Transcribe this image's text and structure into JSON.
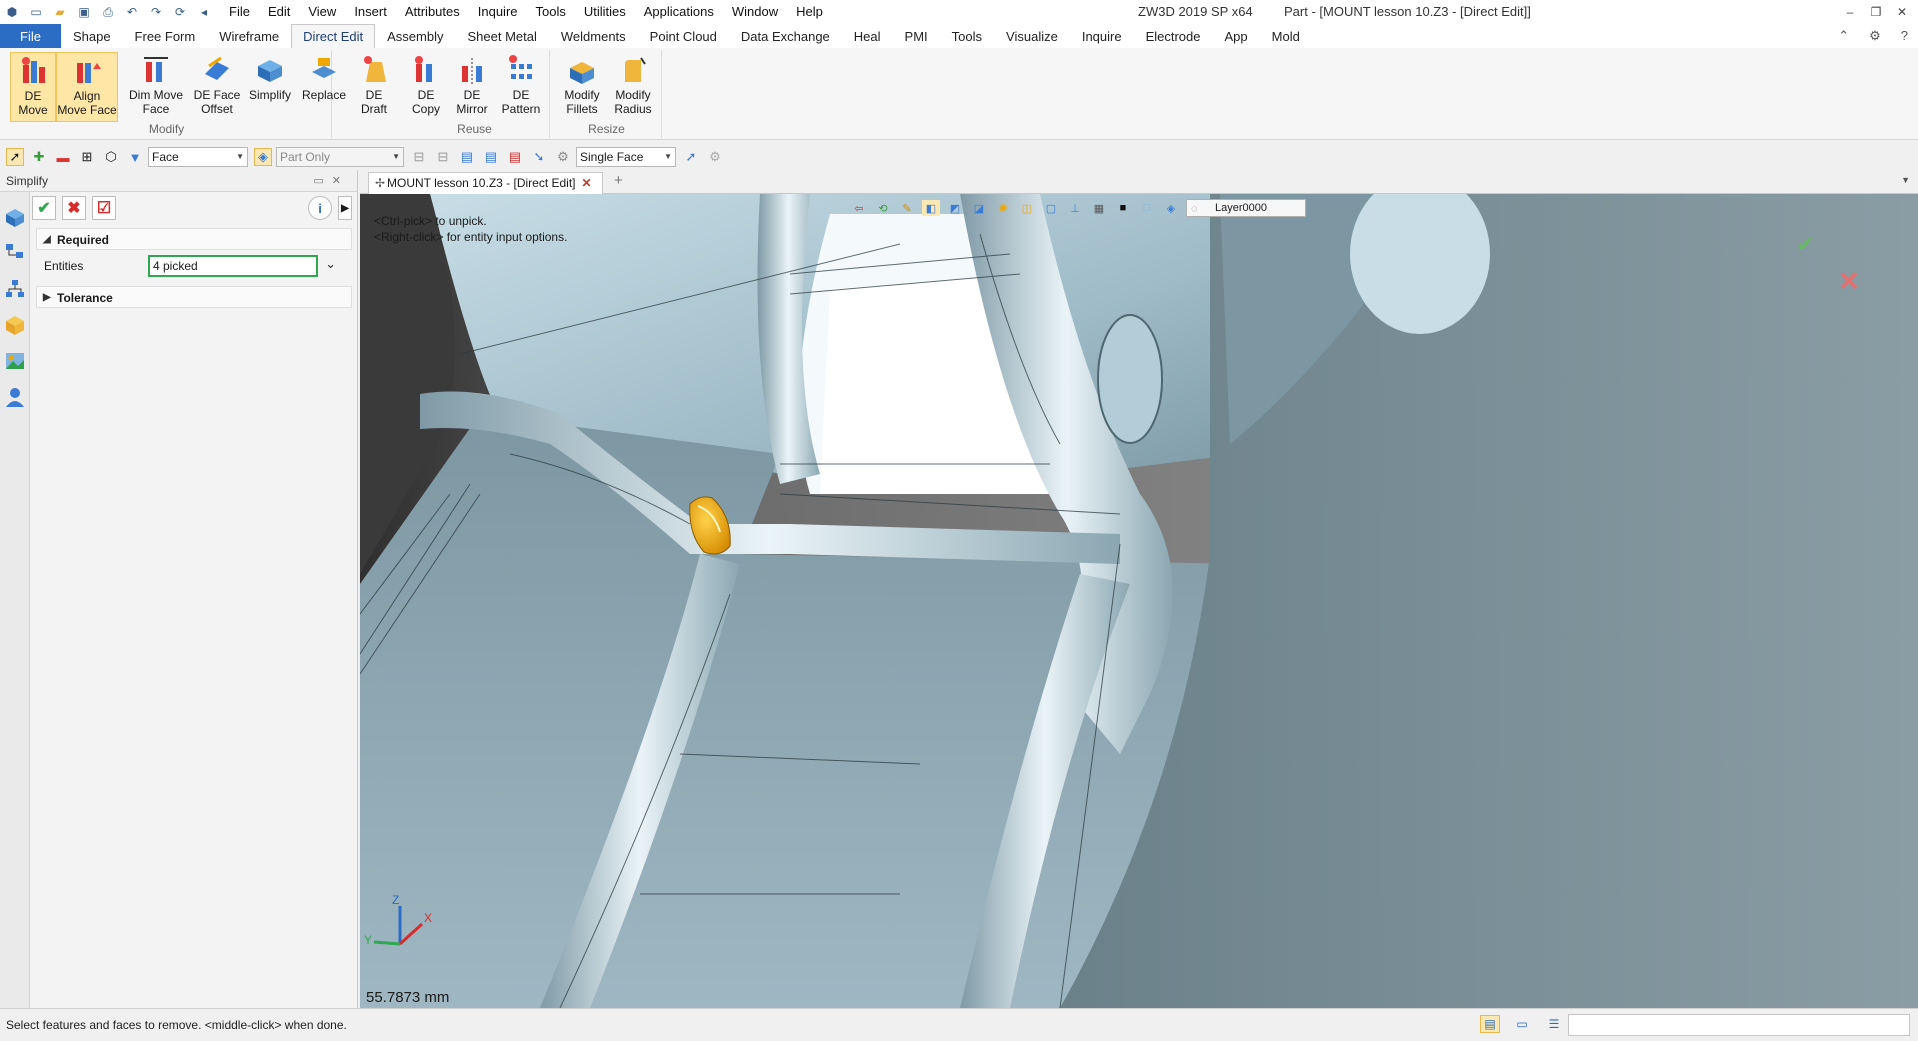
{
  "titlebar": {
    "menus": [
      "File",
      "Edit",
      "View",
      "Insert",
      "Attributes",
      "Inquire",
      "Tools",
      "Utilities",
      "Applications",
      "Window",
      "Help"
    ],
    "app_name": "ZW3D 2019 SP x64",
    "document_title": "Part - [MOUNT lesson 10.Z3 - [Direct Edit]]"
  },
  "ribbon_tabs": [
    "File",
    "Shape",
    "Free Form",
    "Wireframe",
    "Direct Edit",
    "Assembly",
    "Sheet Metal",
    "Weldments",
    "Point Cloud",
    "Data Exchange",
    "Heal",
    "PMI",
    "Tools",
    "Visualize",
    "Inquire",
    "Electrode",
    "App",
    "Mold"
  ],
  "active_tab": "Direct Edit",
  "ribbon": {
    "modify": {
      "label": "Modify",
      "buttons": [
        "DE\nMove",
        "Align\nMove Face",
        "Dim Move\nFace",
        "DE Face\nOffset",
        "Simplify",
        "Replace",
        "DE\nDraft"
      ]
    },
    "reuse": {
      "label": "Reuse",
      "buttons": [
        "DE\nCopy",
        "DE\nMirror",
        "DE\nPattern"
      ]
    },
    "resize": {
      "label": "Resize",
      "buttons": [
        "Modify\nFillets",
        "Modify\nRadius"
      ]
    }
  },
  "filterbar": {
    "filter_value": "Face",
    "scope_value": "Part Only",
    "pick_mode_value": "Single Face"
  },
  "panel": {
    "title": "Simplify",
    "required_label": "Required",
    "entities_label": "Entities",
    "entities_value": "4 picked",
    "tolerance_label": "Tolerance"
  },
  "document_tab": {
    "label": "MOUNT lesson 10.Z3 - [Direct Edit]"
  },
  "viewport": {
    "hint_line1": "<Ctrl-pick> to unpick.",
    "hint_line2": "<Right-click> for entity input options.",
    "layer": "Layer0000",
    "measurement": "55.7873 mm",
    "triad_labels": {
      "x": "X",
      "y": "Y",
      "z": "Z"
    },
    "highlight_color": "#f0a800",
    "part_color": "#9fbfcc"
  },
  "statusbar": {
    "message": "Select features and faces to remove.  <middle-click> when done."
  },
  "colors": {
    "file_tab": "#2b6cc4",
    "active_button": "#fde6a6",
    "confirm_green": "#2fa84f",
    "cancel_red": "#d62c2c"
  }
}
